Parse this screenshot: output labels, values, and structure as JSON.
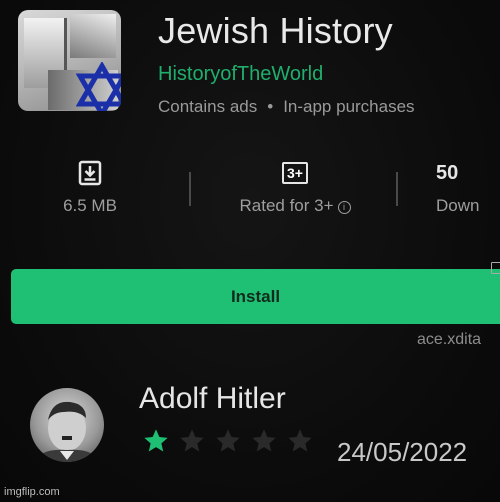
{
  "app": {
    "title": "Jewish History",
    "developer": "HistoryofTheWorld",
    "meta": [
      "Contains ads",
      "In-app purchases"
    ],
    "meta_separator": "•",
    "icon": "star-of-david-icon"
  },
  "stats": {
    "size": {
      "value": "6.5 MB",
      "icon": "download-icon"
    },
    "rating": {
      "badge": "3+",
      "label": "Rated for 3+",
      "info_icon": "i"
    },
    "downloads": {
      "value": "50",
      "label": "Down"
    }
  },
  "install": {
    "label": "Install"
  },
  "ad_url": "ace.xdita",
  "review": {
    "author": "Adolf Hitler",
    "rating": 1,
    "max_rating": 5,
    "date": "24/05/2022"
  },
  "watermark": "imgflip.com",
  "colors": {
    "accent": "#1fbf74",
    "developer": "#1fae6c",
    "star_filled": "#1fbf74",
    "star_empty": "#2a2a2a",
    "david_star": "#1a2fa8"
  }
}
